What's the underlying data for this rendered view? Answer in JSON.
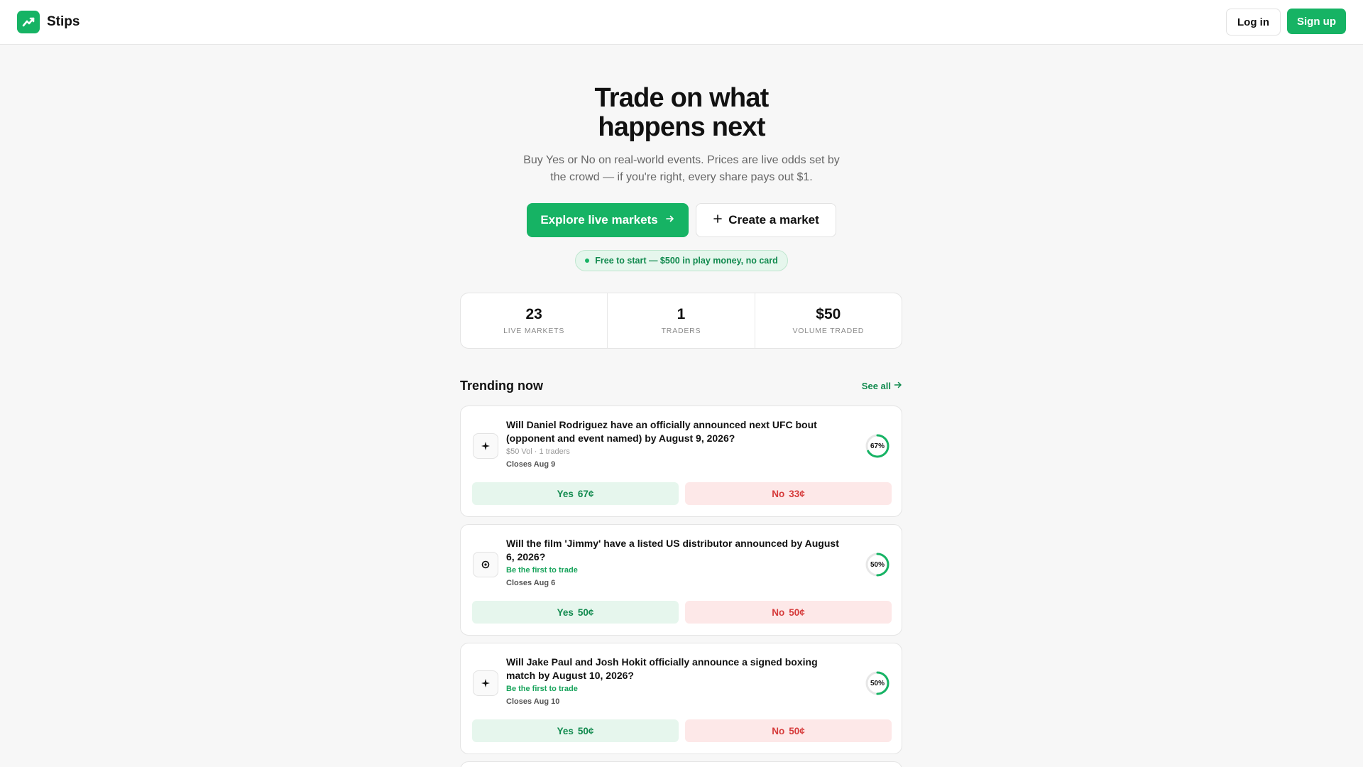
{
  "header": {
    "brand": "Stips",
    "login_label": "Log in",
    "signup_label": "Sign up"
  },
  "hero": {
    "title_line1": "Trade on what",
    "title_line2": "happens next",
    "subtitle_line1": "Buy Yes or No on real-world events. Prices are live odds set by",
    "subtitle_line2": "the crowd — if you're right, every share pays out $1.",
    "explore_label": "Explore live markets",
    "create_label": "Create a market",
    "promo": "Free to start — $500 in play money, no card"
  },
  "stats": [
    {
      "value": "23",
      "label": "LIVE MARKETS"
    },
    {
      "value": "1",
      "label": "TRADERS"
    },
    {
      "value": "$50",
      "label": "VOLUME TRADED"
    }
  ],
  "trending": {
    "title": "Trending now",
    "see_all": "See all"
  },
  "markets": [
    {
      "question": "Will Daniel Rodriguez have an officially announced next UFC bout (opponent and event named) by August 9, 2026?",
      "meta": "$50 Vol · 1 traders",
      "closes": "Closes Aug 9",
      "percent_label": "67%",
      "yes_fraction": 0.67,
      "yes_label": "Yes",
      "yes_price": "67¢",
      "no_label": "No",
      "no_price": "33¢",
      "icon": "sparkle-icon"
    },
    {
      "question": "Will the film 'Jimmy' have a listed US distributor announced by August 6, 2026?",
      "meta": "Be the first to trade",
      "closes": "Closes Aug 6",
      "percent_label": "50%",
      "yes_fraction": 0.5,
      "yes_label": "Yes",
      "yes_price": "50¢",
      "no_label": "No",
      "no_price": "50¢",
      "icon": "film-reel-icon"
    },
    {
      "question": "Will Jake Paul and Josh Hokit officially announce a signed boxing match by August 10, 2026?",
      "meta": "Be the first to trade",
      "closes": "Closes Aug 10",
      "percent_label": "50%",
      "yes_fraction": 0.5,
      "yes_label": "Yes",
      "yes_price": "50¢",
      "no_label": "No",
      "no_price": "50¢",
      "icon": "sparkle-icon"
    }
  ],
  "colors": {
    "accent": "#16b364",
    "yes_bg": "#e6f6ed",
    "no_bg": "#fde8e8",
    "no_text": "#d63b3b"
  }
}
